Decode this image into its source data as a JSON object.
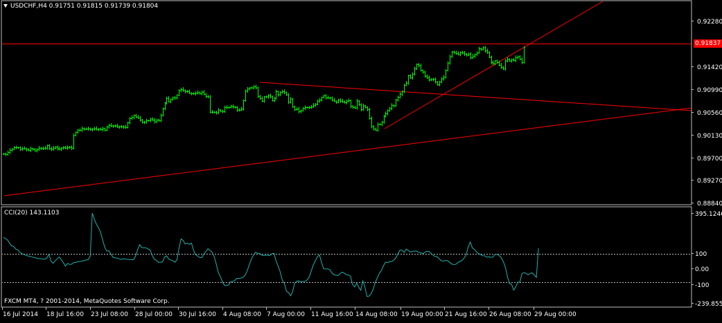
{
  "colors": {
    "background": "#000000",
    "frame": "#c0c0c0",
    "candle": "#00ff00",
    "trendline": "#ff0000",
    "price_marker": "#ff0000",
    "cci_line": "#20b2aa",
    "level_line": "#c0c0c0"
  },
  "price_panel": {
    "header_icon": "dropdown-triangle-icon",
    "header": "USDCHF,H4  0.91751 0.91815 0.91739 0.91804",
    "current_price": "0.91837"
  },
  "cci_panel": {
    "title": "CCI(20) 143.1103"
  },
  "footer": {
    "copyright": "FXCM MT4, ? 2001-2014, MetaQuotes Software Corp."
  },
  "chart_data": [
    {
      "type": "line",
      "name": "USDCHF H4 price",
      "y_ticks": [
        "0.92280",
        "0.91420",
        "0.90990",
        "0.90560",
        "0.90130",
        "0.89700",
        "0.89270",
        "0.88840"
      ],
      "ylim": [
        0.8884,
        0.9271
      ],
      "x_labels": [
        "16 Jul 2014",
        "18 Jul 16:00",
        "23 Jul 08:00",
        "28 Jul 00:00",
        "30 Jul 16:00",
        "4 Aug 08:00",
        "7 Aug 00:00",
        "11 Aug 16:00",
        "14 Aug 08:00",
        "19 Aug 00:00",
        "21 Aug 16:00",
        "26 Aug 08:00",
        "29 Aug 00:00"
      ],
      "x": [
        0,
        3,
        6,
        9,
        12,
        15,
        18,
        21,
        24,
        27,
        30,
        33,
        36,
        39,
        42,
        45,
        48,
        51,
        54,
        57,
        60,
        63,
        66,
        69,
        72,
        75,
        78,
        81,
        84,
        87,
        90,
        93,
        96,
        99,
        102,
        105,
        108,
        111,
        114,
        117,
        120,
        123,
        126,
        129,
        132,
        135,
        138,
        141,
        144,
        147,
        150,
        153,
        156,
        159,
        162,
        165,
        168,
        171,
        174,
        177,
        180,
        183,
        186,
        189,
        192,
        195,
        198,
        201,
        204,
        207,
        210,
        213,
        216,
        219,
        222,
        225,
        228,
        231,
        234,
        237,
        240,
        243,
        246,
        249,
        252,
        255,
        258,
        261,
        264,
        267,
        270,
        273,
        276,
        279,
        282,
        285,
        288,
        291,
        294,
        297,
        300,
        303,
        306,
        309,
        312,
        315,
        318,
        321,
        324,
        327,
        330,
        333,
        336,
        339,
        342,
        345,
        348,
        351,
        354,
        357,
        360,
        363,
        366,
        369,
        372,
        375,
        378,
        381,
        384,
        387,
        390,
        393,
        396,
        399,
        402,
        405,
        408,
        411,
        414,
        417,
        420,
        423,
        426,
        429,
        432,
        435,
        438,
        441,
        444,
        447,
        450,
        453,
        456,
        459,
        462,
        465,
        468,
        471,
        474,
        477,
        480,
        483,
        486,
        489,
        492,
        495,
        498,
        501,
        504,
        507,
        510,
        513,
        516,
        519,
        522,
        525,
        528,
        531,
        534,
        537,
        540,
        543,
        546,
        549,
        552,
        555,
        558,
        561,
        564,
        567,
        570,
        573,
        576,
        579,
        582,
        585,
        588,
        591,
        594,
        597,
        600,
        603,
        606,
        609,
        612,
        615,
        618,
        621,
        624,
        627,
        630,
        633,
        636,
        639,
        642,
        645,
        648,
        651,
        654,
        657,
        660,
        663,
        666,
        669,
        672,
        675,
        678,
        681,
        684,
        687,
        690,
        693,
        696,
        699,
        702,
        705,
        708,
        711,
        714,
        717,
        720,
        723,
        726,
        729,
        732,
        735,
        738,
        741,
        744,
        747,
        750,
        753,
        756,
        759,
        762,
        765,
        768,
        771,
        774,
        777,
        780,
        783,
        786,
        789
      ],
      "values": [
        0.8976,
        0.8975,
        0.8979,
        0.8983,
        0.8985,
        0.8988,
        0.8988,
        0.8988,
        0.8985,
        0.8986,
        0.8986,
        0.8984,
        0.8983,
        0.8986,
        0.8985,
        0.8982,
        0.8984,
        0.8987,
        0.8987,
        0.8986,
        0.8987,
        0.8992,
        0.8986,
        0.8985,
        0.8987,
        0.8989,
        0.8986,
        0.8985,
        0.8987,
        0.8988,
        0.8987,
        0.8988,
        0.8989,
        0.8987,
        0.9011,
        0.9017,
        0.9021,
        0.9021,
        0.9024,
        0.9023,
        0.9023,
        0.9024,
        0.9022,
        0.9023,
        0.9024,
        0.9022,
        0.9023,
        0.9022,
        0.9024,
        0.9021,
        0.9027,
        0.903,
        0.9029,
        0.9029,
        0.9029,
        0.9027,
        0.9028,
        0.9027,
        0.9027,
        0.9026,
        0.9035,
        0.9043,
        0.9045,
        0.9049,
        0.9046,
        0.9044,
        0.904,
        0.9036,
        0.9036,
        0.9039,
        0.9039,
        0.9042,
        0.904,
        0.9037,
        0.904,
        0.9039,
        0.9049,
        0.9062,
        0.9072,
        0.9081,
        0.9075,
        0.9079,
        0.9082,
        0.9082,
        0.9087,
        0.9096,
        0.9098,
        0.9096,
        0.9094,
        0.9094,
        0.9091,
        0.909,
        0.909,
        0.9091,
        0.9092,
        0.909,
        0.9093,
        0.9089,
        0.9085,
        0.9084,
        0.9055,
        0.9055,
        0.9055,
        0.9054,
        0.9059,
        0.9057,
        0.9056,
        0.9064,
        0.9064,
        0.9064,
        0.9066,
        0.9065,
        0.9064,
        0.9059,
        0.9059,
        0.9061,
        0.9077,
        0.9095,
        0.9099,
        0.9101,
        0.9101,
        0.9103,
        0.9101,
        0.9085,
        0.9081,
        0.9076,
        0.9084,
        0.9084,
        0.9086,
        0.9084,
        0.9077,
        0.9081,
        0.9094,
        0.9088,
        0.9092,
        0.9094,
        0.9092,
        0.9088,
        0.9074,
        0.908,
        0.9065,
        0.906,
        0.9061,
        0.9056,
        0.9058,
        0.9062,
        0.9064,
        0.9064,
        0.9064,
        0.9065,
        0.9068,
        0.907,
        0.9076,
        0.9078,
        0.9083,
        0.9086,
        0.9082,
        0.9082,
        0.9082,
        0.9078,
        0.9076,
        0.9074,
        0.9078,
        0.9076,
        0.9075,
        0.9073,
        0.9076,
        0.9077,
        0.9066,
        0.9064,
        0.9063,
        0.9076,
        0.9069,
        0.906,
        0.9067,
        0.9064,
        0.906,
        0.9043,
        0.9028,
        0.9023,
        0.9021,
        0.9032,
        0.9032,
        0.9036,
        0.9047,
        0.9052,
        0.9058,
        0.9062,
        0.9068,
        0.9067,
        0.9078,
        0.9083,
        0.9089,
        0.9094,
        0.9106,
        0.911,
        0.9124,
        0.912,
        0.9127,
        0.9137,
        0.9145,
        0.9143,
        0.9134,
        0.9131,
        0.9123,
        0.912,
        0.9116,
        0.9117,
        0.9117,
        0.9112,
        0.9107,
        0.9112,
        0.9118,
        0.9121,
        0.9134,
        0.9148,
        0.916,
        0.9169,
        0.9168,
        0.9166,
        0.9164,
        0.9168,
        0.9167,
        0.9165,
        0.9163,
        0.9165,
        0.9158,
        0.9161,
        0.9164,
        0.9167,
        0.9175,
        0.9174,
        0.9177,
        0.9171,
        0.9168,
        0.9159,
        0.9149,
        0.9147,
        0.9152,
        0.9149,
        0.9144,
        0.914,
        0.9137,
        0.9152,
        0.9155,
        0.9152,
        0.9154,
        0.9153,
        0.9158,
        0.916,
        0.9155,
        0.9149,
        0.9178
      ]
    },
    {
      "type": "line",
      "name": "CCI(20)",
      "y_ticks": [
        "395.1246",
        "100",
        "0.00",
        "-100",
        "-239.8558"
      ],
      "ylim": [
        -239.8558,
        395.1246
      ],
      "levels": [
        100,
        -100
      ],
      "x": [
        0,
        3,
        6,
        9,
        12,
        15,
        18,
        21,
        24,
        27,
        30,
        33,
        36,
        39,
        42,
        45,
        48,
        51,
        54,
        57,
        60,
        63,
        66,
        69,
        72,
        75,
        78,
        81,
        84,
        87,
        90,
        93,
        96,
        99,
        102,
        105,
        108,
        111,
        114,
        117,
        120,
        123,
        126,
        129,
        132,
        135,
        138,
        141,
        144,
        147,
        150,
        153,
        156,
        159,
        162,
        165,
        168,
        171,
        174,
        177,
        180,
        183,
        186,
        189,
        192,
        195,
        198,
        201,
        204,
        207,
        210,
        213,
        216,
        219,
        222,
        225,
        228,
        231,
        234,
        237,
        240,
        243,
        246,
        249,
        252,
        255,
        258,
        261,
        264,
        267,
        270,
        273,
        276,
        279,
        282,
        285,
        288,
        291,
        294,
        297,
        300,
        303,
        306,
        309,
        312,
        315,
        318,
        321,
        324,
        327,
        330,
        333,
        336,
        339,
        342,
        345,
        348,
        351,
        354,
        357,
        360,
        363,
        366,
        369,
        372,
        375,
        378,
        381,
        384,
        387,
        390,
        393,
        396,
        399,
        402,
        405,
        408,
        411,
        414,
        417,
        420,
        423,
        426,
        429,
        432,
        435,
        438,
        441,
        444,
        447,
        450,
        453,
        456,
        459,
        462,
        465,
        468,
        471,
        474,
        477,
        480,
        483,
        486,
        489,
        492,
        495,
        498,
        501,
        504,
        507,
        510,
        513,
        516,
        519,
        522,
        525,
        528,
        531,
        534,
        537,
        540,
        543,
        546,
        549,
        552,
        555,
        558,
        561,
        564,
        567,
        570,
        573,
        576,
        579,
        582,
        585,
        588,
        591,
        594,
        597,
        600,
        603,
        606,
        609,
        612,
        615,
        618,
        621,
        624,
        627,
        630,
        633,
        636,
        639,
        642,
        645,
        648,
        651,
        654,
        657,
        660,
        663,
        666,
        669,
        672,
        675,
        678,
        681,
        684,
        687,
        690,
        693,
        696,
        699,
        702,
        705,
        708,
        711,
        714,
        717,
        720,
        723,
        726,
        729,
        732,
        735,
        738,
        741,
        744,
        747,
        750,
        753,
        756,
        759,
        762,
        765,
        768,
        771,
        774,
        777,
        780,
        783,
        786,
        789
      ],
      "values": [
        220,
        212,
        201,
        178,
        160,
        154,
        136,
        130,
        113,
        104,
        98,
        91,
        87,
        84,
        79,
        75,
        72,
        68,
        67,
        65,
        64,
        72,
        100,
        51,
        35,
        52,
        66,
        80,
        60,
        40,
        14,
        33,
        27,
        28,
        40,
        41,
        46,
        48,
        50,
        55,
        58,
        61,
        86,
        395,
        350,
        316,
        290,
        258,
        202,
        151,
        122,
        125,
        102,
        78,
        73,
        72,
        66,
        63,
        67,
        65,
        63,
        62,
        61,
        60,
        88,
        135,
        169,
        147,
        146,
        146,
        137,
        130,
        91,
        64,
        56,
        42,
        42,
        44,
        78,
        88,
        64,
        59,
        54,
        42,
        60,
        144,
        210,
        198,
        173,
        180,
        170,
        180,
        128,
        97,
        87,
        76,
        75,
        101,
        119,
        139,
        127,
        114,
        83,
        31,
        -31,
        -60,
        -98,
        -124,
        -124,
        -121,
        -97,
        -96,
        -88,
        -73,
        -74,
        -71,
        -66,
        -50,
        -20,
        24,
        64,
        92,
        113,
        107,
        106,
        93,
        90,
        93,
        91,
        90,
        104,
        106,
        50,
        14,
        -29,
        -86,
        -110,
        -166,
        -175,
        -198,
        -169,
        -107,
        -94,
        -92,
        -99,
        -96,
        -95,
        -85,
        -64,
        -21,
        22,
        53,
        81,
        94,
        40,
        -5,
        -6,
        -5,
        -11,
        -34,
        -48,
        -51,
        -54,
        -39,
        -29,
        -37,
        -47,
        -49,
        -58,
        -118,
        -135,
        -107,
        -136,
        -159,
        -91,
        -137,
        -203,
        -201,
        -184,
        -150,
        -103,
        -69,
        -38,
        -16,
        18,
        43,
        40,
        46,
        48,
        58,
        73,
        103,
        130,
        127,
        113,
        137,
        126,
        115,
        120,
        122,
        123,
        113,
        112,
        102,
        115,
        121,
        120,
        106,
        94,
        83,
        82,
        66,
        53,
        51,
        55,
        53,
        42,
        29,
        26,
        27,
        40,
        48,
        55,
        72,
        94,
        152,
        187,
        144,
        134,
        117,
        104,
        98,
        89,
        88,
        78,
        81,
        77,
        79,
        99,
        99,
        90,
        74,
        47,
        6,
        -63,
        -111,
        -116,
        -158,
        -135,
        -101,
        -101,
        -42,
        -31,
        -38,
        -48,
        -39,
        -34,
        -49,
        -66,
        143
      ]
    }
  ]
}
